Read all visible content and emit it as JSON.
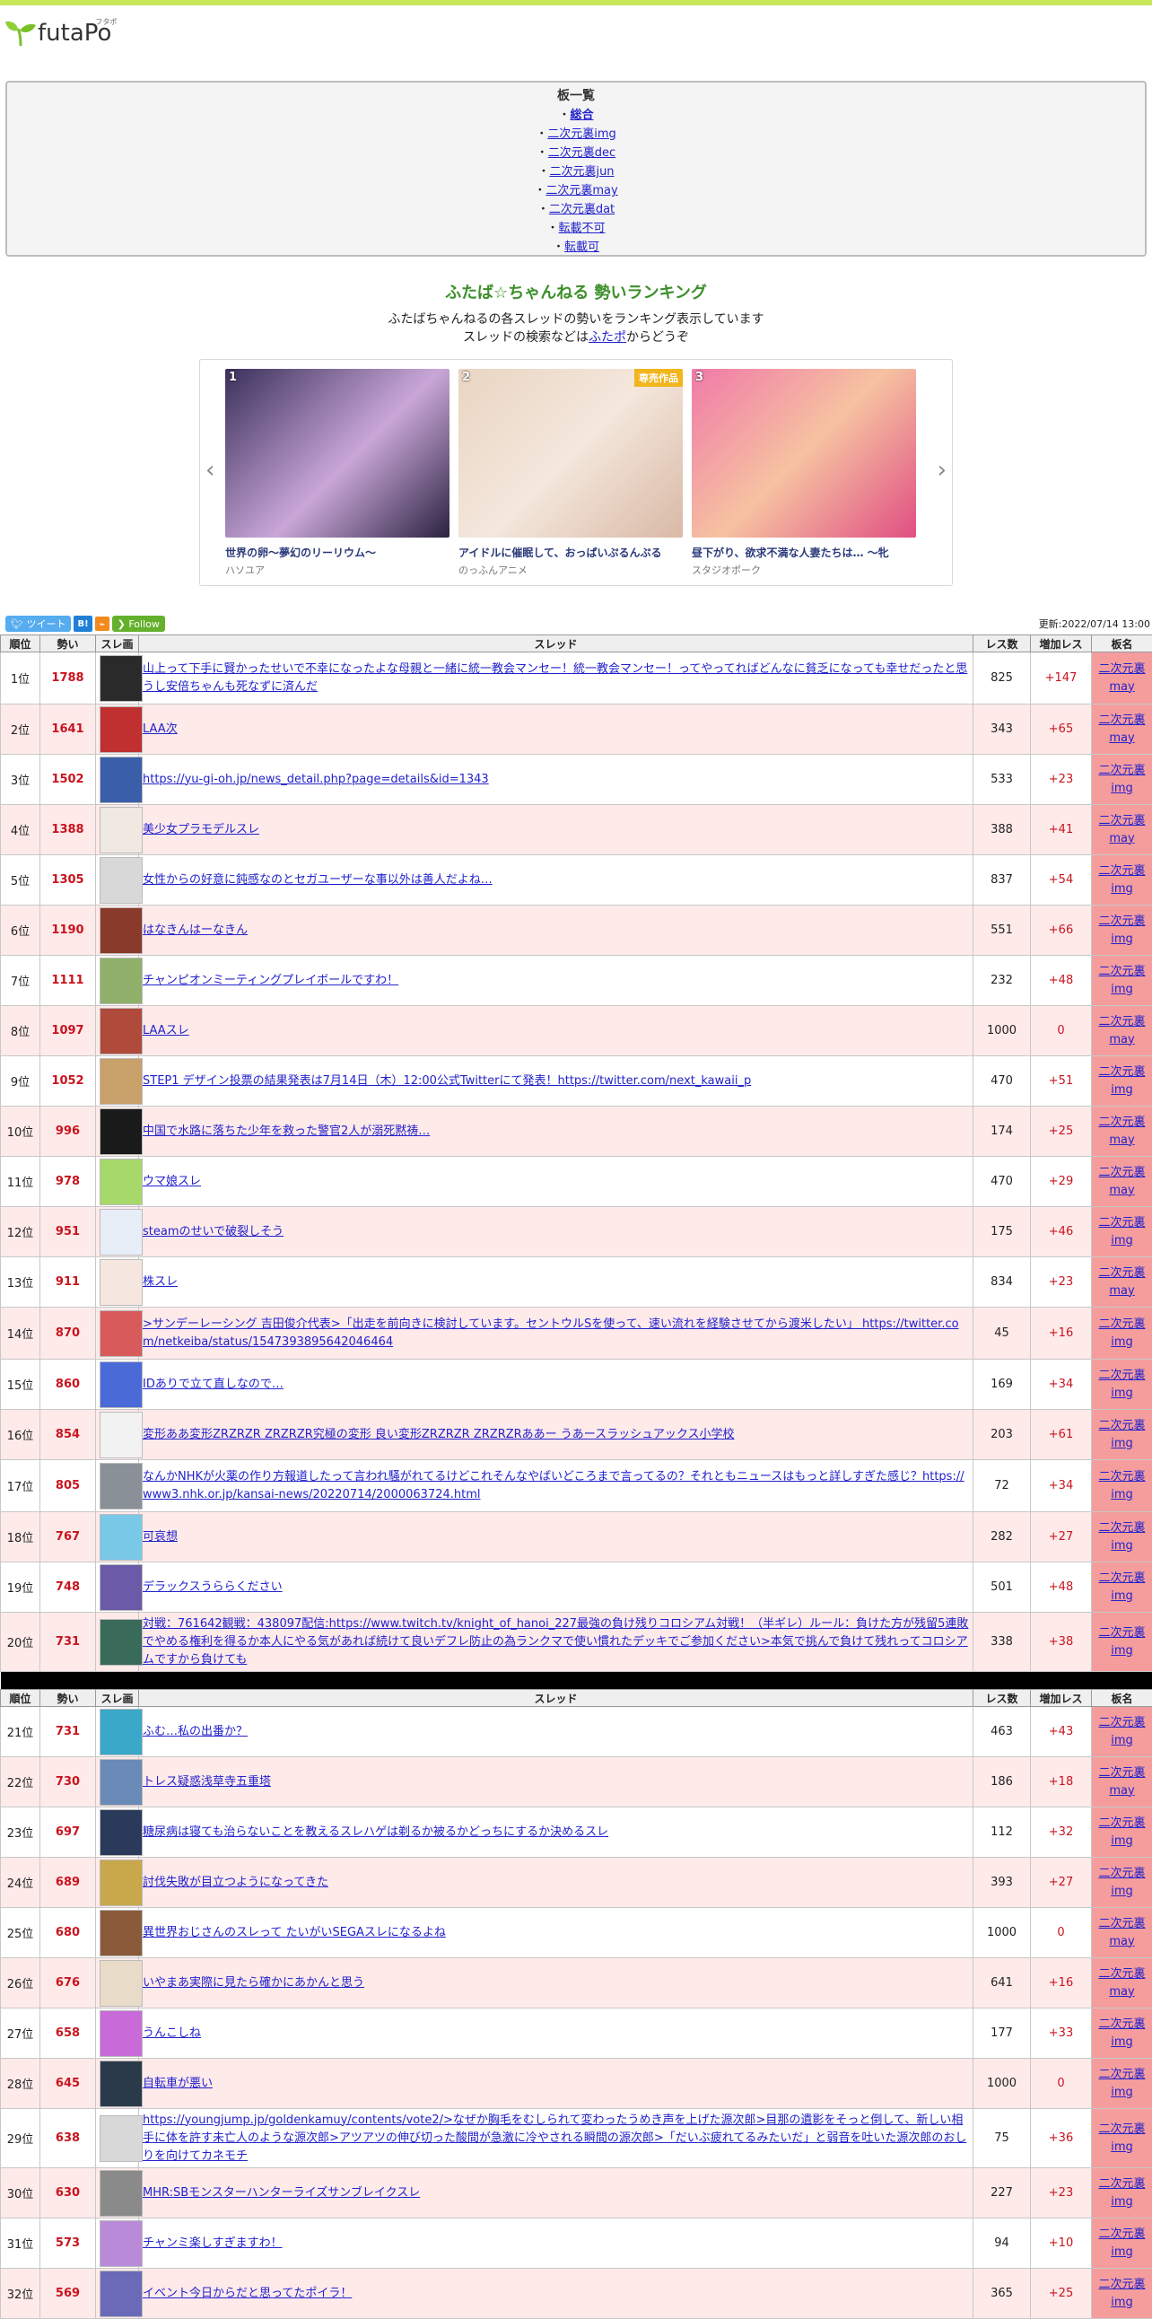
{
  "brand": {
    "name": "futaPo",
    "ruby": "フタポ",
    "accent": "#c8e65a"
  },
  "boards": {
    "heading": "板一覧",
    "items": [
      {
        "label": "総合",
        "bold": true
      },
      {
        "label": "二次元裏img"
      },
      {
        "label": "二次元裏dec"
      },
      {
        "label": "二次元裏jun"
      },
      {
        "label": "二次元裏may"
      },
      {
        "label": "二次元裏dat"
      },
      {
        "label": "転載不可"
      },
      {
        "label": "転載可"
      }
    ]
  },
  "hero": {
    "title": "ふたば☆ちゃんねる 勢いランキング",
    "line1": "ふたばちゃんねるの各スレッドの勢いをランキング表示しています",
    "line2_prefix": "スレッドの検索などは",
    "line2_link": "ふたポ",
    "line2_suffix": "からどうぞ"
  },
  "carousel": {
    "items": [
      {
        "num": "1",
        "title": "世界の卵～夢幻のリーリウム～",
        "maker": "ハソユア",
        "bg": "linear-gradient(135deg,#3a2f5a,#c9a7d8 55%,#2b2240)"
      },
      {
        "num": "2",
        "title": "アイドルに催眠して、おっぱいぷるんぷる",
        "maker": "のっふんアニメ",
        "tag": "専売作品",
        "bg": "linear-gradient(135deg,#e9d5c2,#f4e7dc 50%,#d9b9a6)"
      },
      {
        "num": "3",
        "title": "昼下がり、欲求不満な人妻たちは… ～牝",
        "maker": "スタジオポーク",
        "bg": "linear-gradient(135deg,#f07aa8,#f6c2a1 50%,#e04f83)"
      }
    ]
  },
  "share": {
    "tweet": "ツイート",
    "hatena": "B!",
    "rss": "⌁",
    "follow": "Follow"
  },
  "updated": "更新:2022/07/14 13:00",
  "table": {
    "headers": [
      "順位",
      "勢い",
      "スレ画",
      "スレッド",
      "レス数",
      "増加レス",
      "板名"
    ],
    "rows": [
      {
        "rank": "1位",
        "ikioi": "1788",
        "title": "山上って下手に賢かったせいで不幸になったよな母親と一緒に統一教会マンセー！統一教会マンセー！ってやってればどんなに貧乏になっても幸せだったと思うし安倍ちゃんも死なずに済んだ",
        "res": "825",
        "inc": "+147",
        "board": "二次元裏may",
        "thumb": "#2a2a2a"
      },
      {
        "rank": "2位",
        "ikioi": "1641",
        "title": "LAA次",
        "res": "343",
        "inc": "+65",
        "board": "二次元裏may",
        "thumb": "#c03030"
      },
      {
        "rank": "3位",
        "ikioi": "1502",
        "title": "https://yu-gi-oh.jp/news_detail.php?page=details&id=1343",
        "res": "533",
        "inc": "+23",
        "board": "二次元裏img",
        "thumb": "#3a5ea8"
      },
      {
        "rank": "4位",
        "ikioi": "1388",
        "title": "美少女プラモデルスレ",
        "res": "388",
        "inc": "+41",
        "board": "二次元裏may",
        "thumb": "#efe9e2"
      },
      {
        "rank": "5位",
        "ikioi": "1305",
        "title": "女性からの好意に鈍感なのとセガユーザーな事以外は善人だよね…",
        "res": "837",
        "inc": "+54",
        "board": "二次元裏img",
        "thumb": "#d8d8d8"
      },
      {
        "rank": "6位",
        "ikioi": "1190",
        "title": "はなきんはーなきん",
        "res": "551",
        "inc": "+66",
        "board": "二次元裏img",
        "thumb": "#8a3a2a"
      },
      {
        "rank": "7位",
        "ikioi": "1111",
        "title": "チャンピオンミーティングプレイボールですわ！",
        "res": "232",
        "inc": "+48",
        "board": "二次元裏img",
        "thumb": "#8fb06a"
      },
      {
        "rank": "8位",
        "ikioi": "1097",
        "title": "LAAスレ",
        "res": "1000",
        "inc": "0",
        "board": "二次元裏may",
        "thumb": "#b04a3a"
      },
      {
        "rank": "9位",
        "ikioi": "1052",
        "title": "STEP1 デザイン投票の結果発表は7月14日（木）12:00公式Twitterにて発表！https://twitter.com/next_kawaii_p",
        "res": "470",
        "inc": "+51",
        "board": "二次元裏img",
        "thumb": "#c8a06a"
      },
      {
        "rank": "10位",
        "ikioi": "996",
        "title": "中国で水路に落ちた少年を救った警官2人が溺死黙祷…",
        "res": "174",
        "inc": "+25",
        "board": "二次元裏may",
        "thumb": "#1a1a1a"
      },
      {
        "rank": "11位",
        "ikioi": "978",
        "title": "ウマ娘スレ",
        "res": "470",
        "inc": "+29",
        "board": "二次元裏may",
        "thumb": "#a6d86a"
      },
      {
        "rank": "12位",
        "ikioi": "951",
        "title": "steamのせいで破裂しそう",
        "res": "175",
        "inc": "+46",
        "board": "二次元裏img",
        "thumb": "#e8eef8"
      },
      {
        "rank": "13位",
        "ikioi": "911",
        "title": "株スレ",
        "res": "834",
        "inc": "+23",
        "board": "二次元裏may",
        "thumb": "#f6e6e0"
      },
      {
        "rank": "14位",
        "ikioi": "870",
        "title": ">サンデーレーシング 吉田俊介代表>「出走を前向きに検討しています。セントウルSを使って、速い流れを経験させてから渡米したい」 https://twitter.com/netkeiba/status/1547393895642046464",
        "res": "45",
        "inc": "+16",
        "board": "二次元裏img",
        "thumb": "#d85a5a"
      },
      {
        "rank": "15位",
        "ikioi": "860",
        "title": "IDありで立て直しなので…",
        "res": "169",
        "inc": "+34",
        "board": "二次元裏img",
        "thumb": "#4a6ad8"
      },
      {
        "rank": "16位",
        "ikioi": "854",
        "title": "変形ああ変形ZRZRZR ZRZRZR究極の変形 良い変形ZRZRZR ZRZRZRああー うあースラッシュアックス小学校",
        "res": "203",
        "inc": "+61",
        "board": "二次元裏img",
        "thumb": "#f2f2f2"
      },
      {
        "rank": "17位",
        "ikioi": "805",
        "title": "なんかNHKが火薬の作り方報道したって言われ騒がれてるけどこれそんなやばいどころまで言ってるの？それともニュースはもっと詳しすぎた感じ？https://www3.nhk.or.jp/kansai-news/20220714/2000063724.html",
        "res": "72",
        "inc": "+34",
        "board": "二次元裏img",
        "thumb": "#8a9098"
      },
      {
        "rank": "18位",
        "ikioi": "767",
        "title": "可哀想",
        "res": "282",
        "inc": "+27",
        "board": "二次元裏img",
        "thumb": "#7ac8e8"
      },
      {
        "rank": "19位",
        "ikioi": "748",
        "title": "デラックスうららください",
        "res": "501",
        "inc": "+48",
        "board": "二次元裏img",
        "thumb": "#6a5aa8"
      },
      {
        "rank": "20位",
        "ikioi": "731",
        "title": "対戦：761642観戦：438097配信:https://www.twitch.tv/knight_of_hanoi_227最強の負け残りコロシアム対戦！（半ギレ）ルール：負けた方が残留5連敗でやめる権利を得るか本人にやる気があれば続けて良いデフレ防止の為ランクマで使い慣れたデッキでご参加ください>本気で挑んで負けて残れってコロシアムですから負けても",
        "res": "338",
        "inc": "+38",
        "board": "二次元裏img",
        "thumb": "#3a6a5a"
      },
      {
        "sep": true
      },
      {
        "rank": "21位",
        "ikioi": "731",
        "title": "ふむ…私の出番か？",
        "res": "463",
        "inc": "+43",
        "board": "二次元裏img",
        "thumb": "#3aa8c8"
      },
      {
        "rank": "22位",
        "ikioi": "730",
        "title": "トレス疑惑浅草寺五重塔",
        "res": "186",
        "inc": "+18",
        "board": "二次元裏may",
        "thumb": "#6a8ab8"
      },
      {
        "rank": "23位",
        "ikioi": "697",
        "title": "糖尿病は寝ても治らないことを教えるスレハゲは剃るか被るかどっちにするか決めるスレ",
        "res": "112",
        "inc": "+32",
        "board": "二次元裏img",
        "thumb": "#2a3a5a"
      },
      {
        "rank": "24位",
        "ikioi": "689",
        "title": "討伐失敗が目立つようになってきた",
        "res": "393",
        "inc": "+27",
        "board": "二次元裏img",
        "thumb": "#c8a84a"
      },
      {
        "rank": "25位",
        "ikioi": "680",
        "title": "異世界おじさんのスレって たいがいSEGAスレになるよね",
        "res": "1000",
        "inc": "0",
        "board": "二次元裏may",
        "thumb": "#8a5a3a"
      },
      {
        "rank": "26位",
        "ikioi": "676",
        "title": "いやまあ実際に見たら確かにあかんと思う",
        "res": "641",
        "inc": "+16",
        "board": "二次元裏may",
        "thumb": "#e8dcc8"
      },
      {
        "rank": "27位",
        "ikioi": "658",
        "title": "うんこしね",
        "res": "177",
        "inc": "+33",
        "board": "二次元裏img",
        "thumb": "#c86ad8"
      },
      {
        "rank": "28位",
        "ikioi": "645",
        "title": "自転車が悪い",
        "res": "1000",
        "inc": "0",
        "board": "二次元裏img",
        "thumb": "#2a3a4a"
      },
      {
        "rank": "29位",
        "ikioi": "638",
        "title": "https://youngjump.jp/goldenkamuy/contents/vote2/>なぜか胸毛をむしられて変わったうめき声を上げた源次郎>目那の遺影をそっと倒して、新しい相手に体を許す未亡人のような源次郎>アツアツの伸び切った酸間が急激に冷やされる瞬間の源次郎>「だいぶ疲れてるみたいだ」と弱音を吐いた源次郎のおしりを向けてカネモチ",
        "res": "75",
        "inc": "+36",
        "board": "二次元裏img",
        "thumb": "#d8d8d8"
      },
      {
        "rank": "30位",
        "ikioi": "630",
        "title": "MHR:SBモンスターハンターライズサンブレイクスレ",
        "res": "227",
        "inc": "+23",
        "board": "二次元裏img",
        "thumb": "#8a8a8a"
      },
      {
        "rank": "31位",
        "ikioi": "573",
        "title": "チャンミ楽しすぎますわ！",
        "res": "94",
        "inc": "+10",
        "board": "二次元裏img",
        "thumb": "#b88ad8"
      },
      {
        "rank": "32位",
        "ikioi": "569",
        "title": "イベント今日からだと思ってたポイラ！",
        "res": "365",
        "inc": "+25",
        "board": "二次元裏img",
        "thumb": "#6a6ab8"
      }
    ]
  }
}
